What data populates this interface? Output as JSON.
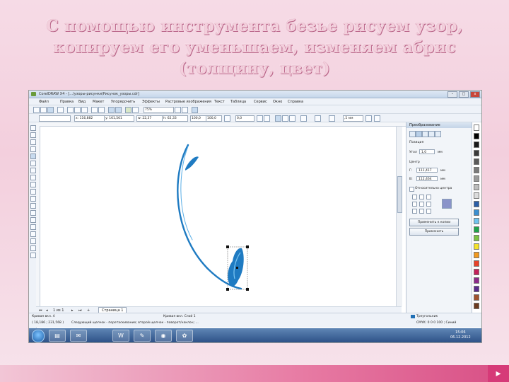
{
  "slide": {
    "title_line1": "С помощью инструмента безье рисуем узор,",
    "title_line2": "копируем его уменьшаем, изменяем абрис",
    "title_line3": "(толщину, цвет)"
  },
  "window": {
    "title": "CorelDRAW X4 - [...\\узоры-рисунки\\Рисунок_узоры.cdr]",
    "min_label": "–",
    "max_label": "□",
    "close_label": "x"
  },
  "menu": [
    "Файл",
    "Правка",
    "Вид",
    "Макет",
    "Упорядочить",
    "Эффекты",
    "Растровые изображения",
    "Текст",
    "Таблица",
    "Сервис",
    "Окно",
    "Справка"
  ],
  "property_bar": {
    "x_field": "x: 116,882",
    "y_field": "y: 161,561",
    "w_field": "w: 22,37",
    "h_field": "h: 62,33",
    "scale_w": "100,0",
    "scale_h": "100,0",
    "rotation": "0,0",
    "zoom": "75%",
    "outline_width": ",5 мм"
  },
  "pagebar": {
    "nav_label": "1 из 1",
    "page_tab": "Страница 1"
  },
  "docker": {
    "title": "Преобразование",
    "position_label": "Позиция",
    "width_label": "Угол",
    "width_value": "1,0",
    "center_label": "Центр",
    "x_label": "Г:",
    "x_value": "111,417",
    "y_label": "В:",
    "y_value": "112,464",
    "unit": "мм",
    "relative_label": "Относительно центра",
    "apply_copy_label": "Применить к копии",
    "apply_label": "Применить"
  },
  "status": {
    "object_info": "Кривая вкл. 4",
    "layer_info": "Кривая вкл. Слой 1",
    "coords": "( 18,186 ; 231,568 )",
    "hint": "Следующий щелчок - перетаскивание; второй щелчок - поворот/наклон; ...",
    "fill_label": "Треугольник",
    "outline_label": "CMYK: 0 0 0 100 ; Синий",
    "fill_color": "#1f6fb5"
  },
  "taskbar": {
    "time": "15:06",
    "date": "06.12.2012",
    "apps": [
      "folder-icon",
      "mail-icon",
      "corel-icon",
      "word-icon",
      "paint-icon",
      "chrome-icon",
      "corel-draw-icon"
    ]
  },
  "palette_colors": [
    "#ffffff",
    "#000000",
    "#1a1a1a",
    "#3a3a3a",
    "#5a5a5a",
    "#7a7a7a",
    "#9a9a9a",
    "#bdbdbd",
    "#dcdcdc",
    "#2b5fa8",
    "#3b8fd0",
    "#6fc3ee",
    "#1fa34a",
    "#7cc242",
    "#f4e22a",
    "#f29a1f",
    "#e8432b",
    "#c5215b",
    "#8c2a8a",
    "#5a2b8c",
    "#a0522d",
    "#6b3a1f"
  ],
  "drawing_color": "#1f7bc2"
}
